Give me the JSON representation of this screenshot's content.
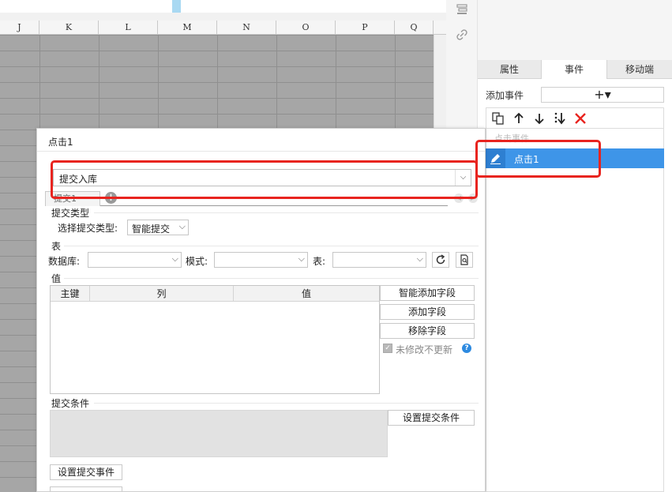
{
  "sheet": {
    "columns": [
      "J",
      "K",
      "L",
      "M",
      "N",
      "O",
      "P",
      "Q"
    ]
  },
  "right_panel": {
    "tabs": [
      {
        "label": "属性",
        "active": false
      },
      {
        "label": "事件",
        "active": true
      },
      {
        "label": "移动端",
        "active": false
      }
    ],
    "add_event_label": "添加事件",
    "add_event_button": "+▾",
    "event_section_label": "点击事件",
    "event_item": "点击1",
    "accent_color": "#3e95e8"
  },
  "dialog": {
    "title": "点击1",
    "submit_select_value": "提交入库",
    "submit_tab": "提交1",
    "submit_type": {
      "section": "提交类型",
      "label": "选择提交类型:",
      "value": "智能提交"
    },
    "table": {
      "section": "表",
      "db_label": "数据库:",
      "db_value": "",
      "schema_label": "模式:",
      "schema_value": "",
      "table_label": "表:",
      "table_value": ""
    },
    "values": {
      "section": "值",
      "columns": [
        "主键",
        "列",
        "值"
      ],
      "smart_add_button": "智能添加字段",
      "add_button": "添加字段",
      "remove_button": "移除字段",
      "keep_checkbox_label": "未修改不更新",
      "keep_checked": true
    },
    "conditions": {
      "section": "提交条件",
      "set_button": "设置提交条件"
    },
    "set_submit_event_button": "设置提交事件"
  }
}
